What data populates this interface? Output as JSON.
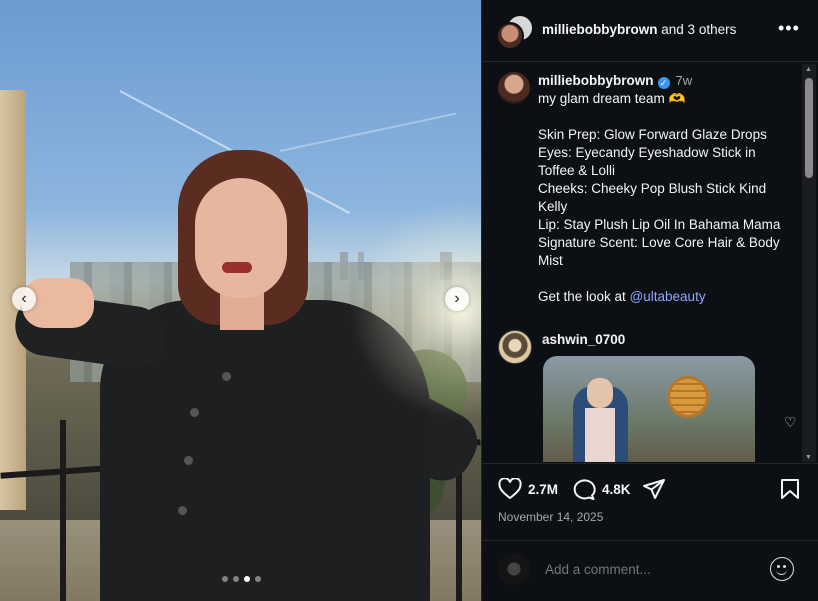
{
  "post_image": {
    "prev_icon": "chevron-left-icon",
    "next_icon": "chevron-right-icon",
    "carousel": {
      "total": 4,
      "active_index": 2
    }
  },
  "header": {
    "username": "milliebobbybrown",
    "others_text": "and 3 others",
    "more_icon": "•••"
  },
  "caption": {
    "username": "milliebobbybrown",
    "verified_icon": "✓",
    "time": "7w",
    "lines_1": [
      "my glam dream team 🫶"
    ],
    "lines_2": [
      "Skin Prep: Glow Forward Glaze Drops",
      "Eyes: Eyecandy Eyeshadow Stick in",
      "Toffee & Lolli",
      "Cheeks: Cheeky Pop Blush Stick Kind",
      "Kelly",
      "Lip: Stay Plush Lip Oil In Bahama Mama",
      "Signature Scent: Love Core Hair & Body",
      "Mist"
    ],
    "cta_text": "Get the look at ",
    "mention": "@ultabeauty"
  },
  "comment": {
    "username": "ashwin_0700",
    "heart_icon": "♡"
  },
  "actions": {
    "likes": "2.7M",
    "comments": "4.8K",
    "date": "November 14, 2025"
  },
  "add_comment": {
    "placeholder": "Add a comment..."
  },
  "scroll": {
    "up_icon": "▲",
    "down_icon": "▼"
  }
}
